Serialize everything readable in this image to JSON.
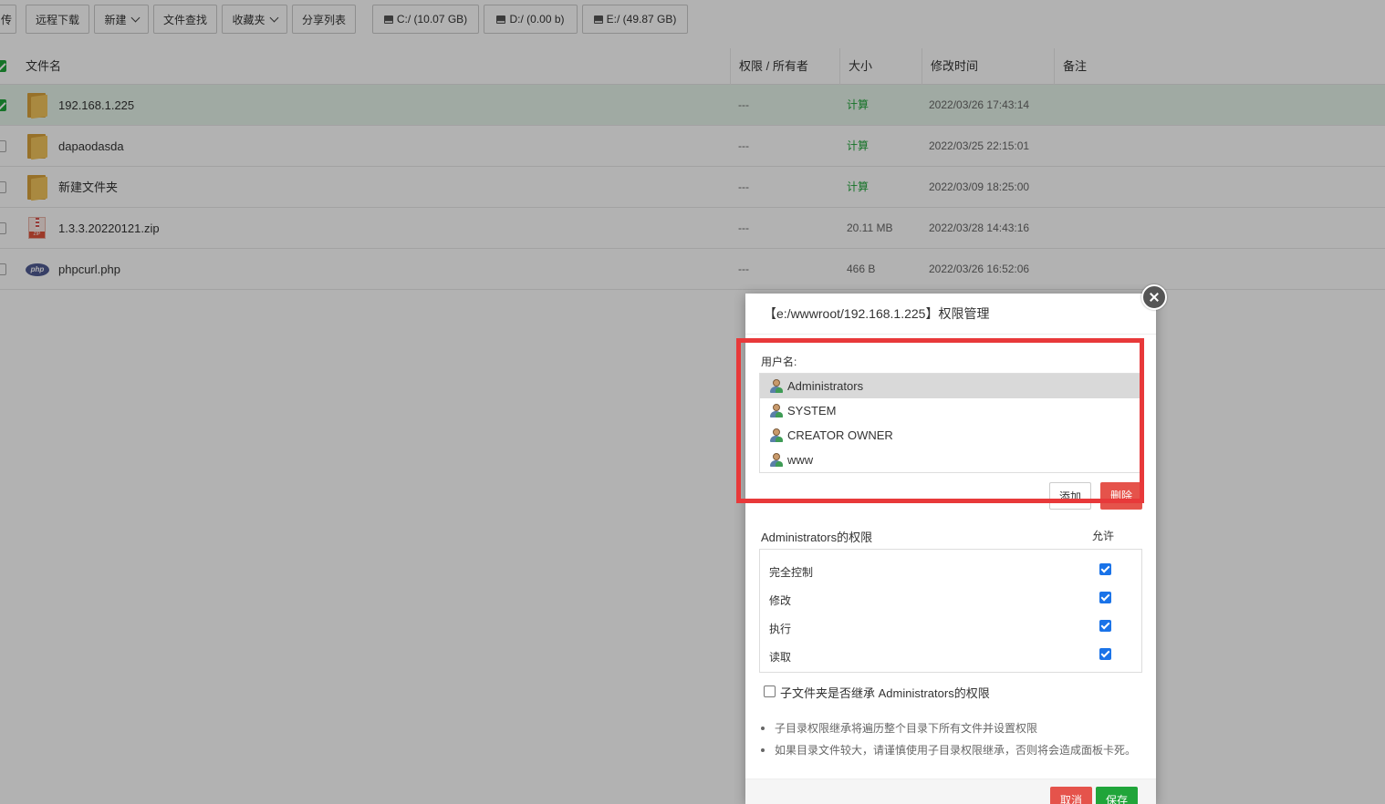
{
  "toolbar": {
    "buttons": [
      {
        "label": "传"
      },
      {
        "label": "远程下载"
      },
      {
        "label": "新建"
      },
      {
        "label": "文件查找"
      },
      {
        "label": "收藏夹"
      },
      {
        "label": "分享列表"
      }
    ],
    "disks": [
      {
        "label": "C:/ (10.07 GB)",
        "icon": "hard-disk-icon"
      },
      {
        "label": "D:/ (0.00 b)",
        "icon": "hard-disk-icon"
      },
      {
        "label": "E:/ (49.87 GB)",
        "icon": "hard-disk-icon"
      }
    ]
  },
  "table": {
    "headers": {
      "name": "文件名",
      "perm": "权限 / 所有者",
      "size": "大小",
      "mtime": "修改时间",
      "note": "备注"
    },
    "rows": [
      {
        "name": "192.168.1.225",
        "perm": "---",
        "size": "计算",
        "mtime": "2022/03/26 17:43:14",
        "type": "folder",
        "checked": true
      },
      {
        "name": "dapaodasda",
        "perm": "---",
        "size": "计算",
        "mtime": "2022/03/25 22:15:01",
        "type": "folder",
        "checked": false
      },
      {
        "name": "新建文件夹",
        "perm": "---",
        "size": "计算",
        "mtime": "2022/03/09 18:25:00",
        "type": "folder",
        "checked": false
      },
      {
        "name": "1.3.3.20220121.zip",
        "perm": "---",
        "size": "20.11 MB",
        "mtime": "2022/03/28 14:43:16",
        "type": "zip",
        "checked": false
      },
      {
        "name": "phpcurl.php",
        "perm": "---",
        "size": "466 B",
        "mtime": "2022/03/26 16:52:06",
        "type": "php",
        "checked": false
      }
    ]
  },
  "dialog": {
    "title": "【e:/wwwroot/192.168.1.225】权限管理",
    "username_label": "用户名:",
    "users": [
      {
        "name": "Administrators",
        "selected": true
      },
      {
        "name": "SYSTEM",
        "selected": false
      },
      {
        "name": "CREATOR OWNER",
        "selected": false
      },
      {
        "name": "www",
        "selected": false
      }
    ],
    "add_label": "添加",
    "delete_label": "删除",
    "perm_title": "Administrators的权限",
    "allow_label": "允许",
    "permissions": [
      {
        "label": "完全控制",
        "allowed": true
      },
      {
        "label": "修改",
        "allowed": true
      },
      {
        "label": "执行",
        "allowed": true
      },
      {
        "label": "读取",
        "allowed": true
      }
    ],
    "inherit_label": "子文件夹是否继承 Administrators的权限",
    "notes": [
      "子目录权限继承将遍历整个目录下所有文件并设置权限",
      "如果目录文件较大，请谨慎使用子目录权限继承，否则将会造成面板卡死。"
    ],
    "cancel_label": "取消",
    "save_label": "保存"
  },
  "colors": {
    "accent_green": "#20a53a",
    "danger_red": "#e5534b",
    "highlight_red": "#e8393a",
    "checkbox_blue": "#1a73e8"
  }
}
